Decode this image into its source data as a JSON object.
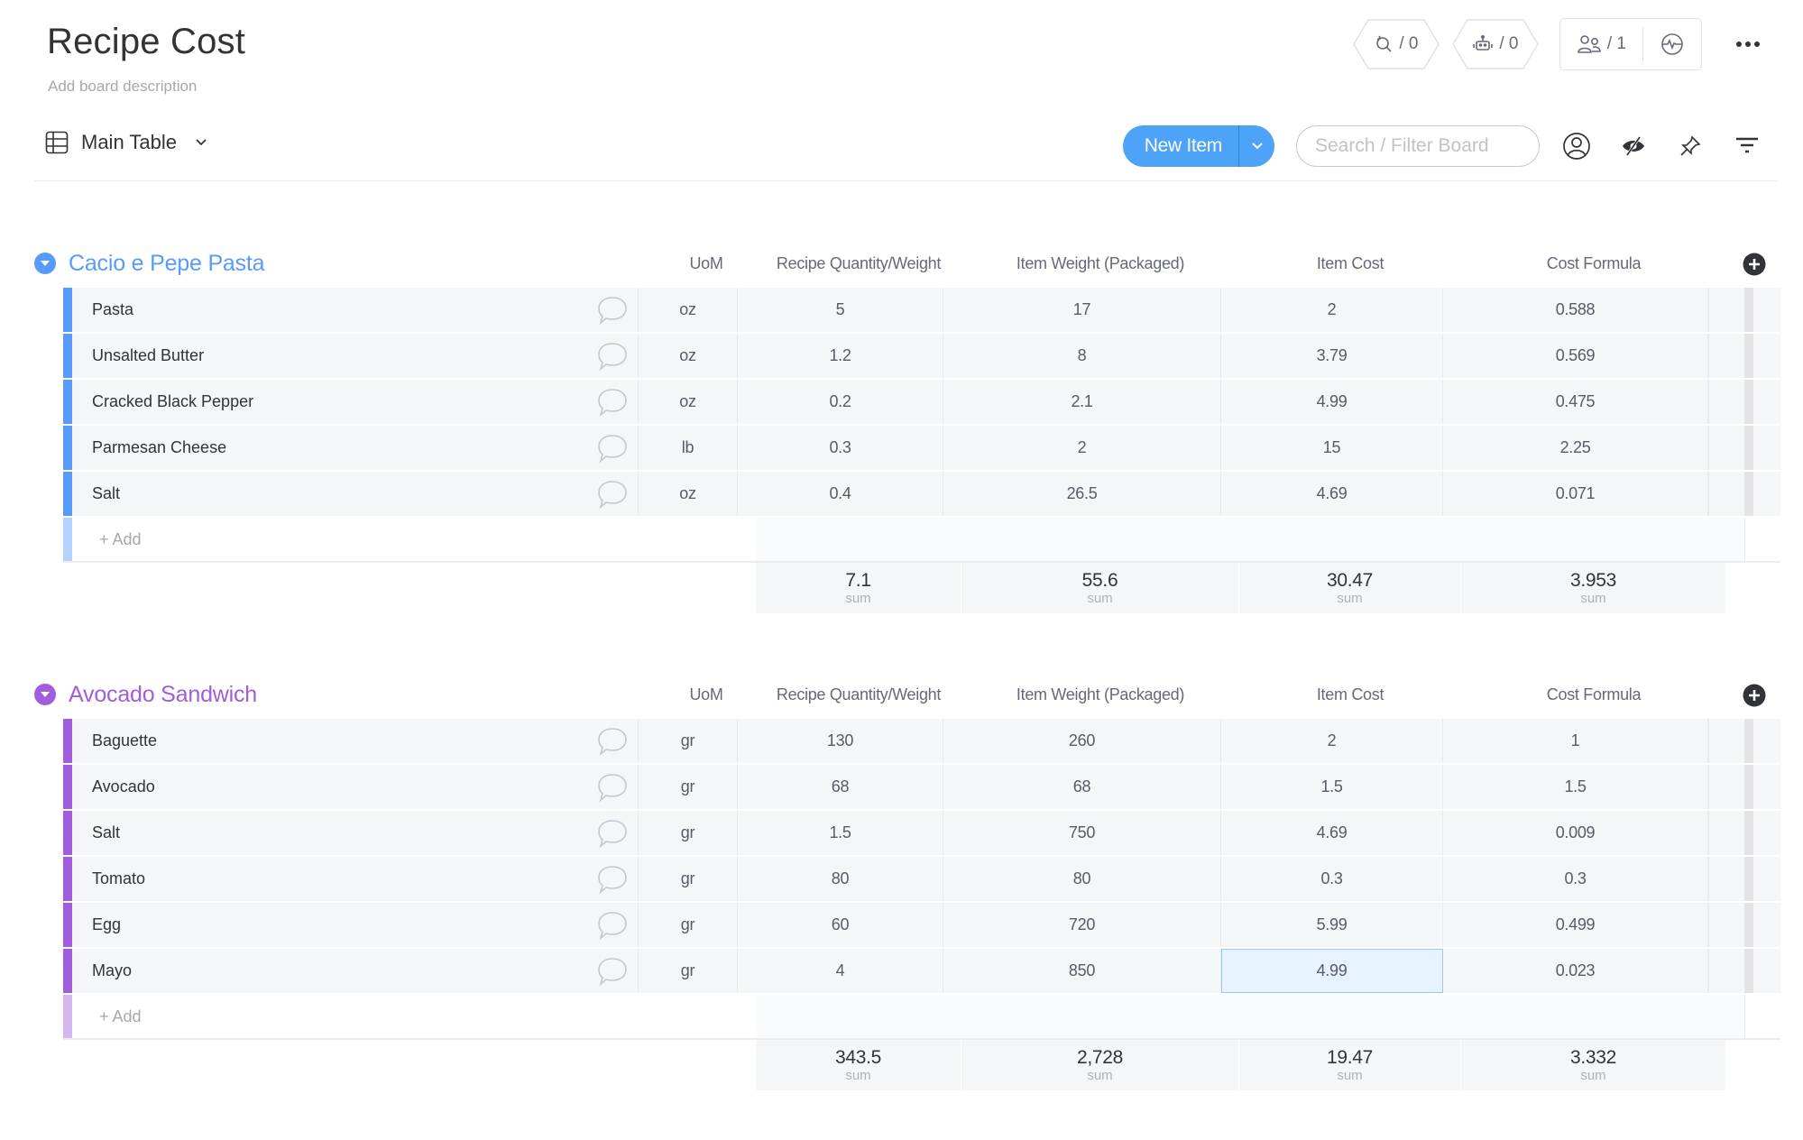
{
  "board": {
    "title": "Recipe Cost",
    "description": "Add board description"
  },
  "top_actions": {
    "integrations": {
      "icon": "integrations-icon",
      "label": "/ 0"
    },
    "automations": {
      "icon": "robot-icon",
      "label": "/ 0"
    },
    "members": {
      "icon": "people-icon",
      "label": "/ 1"
    },
    "activity": {
      "icon": "activity-icon"
    },
    "more": {
      "icon": "more-dots-icon"
    }
  },
  "view": {
    "icon": "table-icon",
    "label": "Main Table"
  },
  "toolbar": {
    "new_item_label": "New Item",
    "search_placeholder": "Search / Filter Board",
    "search_value": "",
    "icons": [
      "person-filter-icon",
      "hide-eye-icon",
      "pin-icon",
      "filter-icon"
    ]
  },
  "columns": [
    "UoM",
    "Recipe Quantity/Weight",
    "Item Weight (Packaged)",
    "Item Cost",
    "Cost Formula"
  ],
  "groups": [
    {
      "title": "Cacio e Pepe Pasta",
      "color": "#579bfc",
      "add_label": "+ Add",
      "items": [
        {
          "name": "Pasta",
          "uom": "oz",
          "qty": "5",
          "weight": "17",
          "cost": "2",
          "formula": "0.588"
        },
        {
          "name": "Unsalted Butter",
          "uom": "oz",
          "qty": "1.2",
          "weight": "8",
          "cost": "3.79",
          "formula": "0.569"
        },
        {
          "name": "Cracked Black Pepper",
          "uom": "oz",
          "qty": "0.2",
          "weight": "2.1",
          "cost": "4.99",
          "formula": "0.475"
        },
        {
          "name": "Parmesan Cheese",
          "uom": "lb",
          "qty": "0.3",
          "weight": "2",
          "cost": "15",
          "formula": "2.25"
        },
        {
          "name": "Salt",
          "uom": "oz",
          "qty": "0.4",
          "weight": "26.5",
          "cost": "4.69",
          "formula": "0.071"
        }
      ],
      "sums": [
        {
          "value": "7.1",
          "label": "sum"
        },
        {
          "value": "55.6",
          "label": "sum"
        },
        {
          "value": "30.47",
          "label": "sum"
        },
        {
          "value": "3.953",
          "label": "sum"
        }
      ]
    },
    {
      "title": "Avocado Sandwich",
      "color": "#a25ddc",
      "add_label": "+ Add",
      "items": [
        {
          "name": "Baguette",
          "uom": "gr",
          "qty": "130",
          "weight": "260",
          "cost": "2",
          "formula": "1"
        },
        {
          "name": "Avocado",
          "uom": "gr",
          "qty": "68",
          "weight": "68",
          "cost": "1.5",
          "formula": "1.5"
        },
        {
          "name": "Salt",
          "uom": "gr",
          "qty": "1.5",
          "weight": "750",
          "cost": "4.69",
          "formula": "0.009"
        },
        {
          "name": "Tomato",
          "uom": "gr",
          "qty": "80",
          "weight": "80",
          "cost": "0.3",
          "formula": "0.3"
        },
        {
          "name": "Egg",
          "uom": "gr",
          "qty": "60",
          "weight": "720",
          "cost": "5.99",
          "formula": "0.499"
        },
        {
          "name": "Mayo",
          "uom": "gr",
          "qty": "4",
          "weight": "850",
          "cost": "4.99",
          "formula": "0.023",
          "selected_cell": "cost"
        }
      ],
      "sums": [
        {
          "value": "343.5",
          "label": "sum"
        },
        {
          "value": "2,728",
          "label": "sum"
        },
        {
          "value": "19.47",
          "label": "sum"
        },
        {
          "value": "3.332",
          "label": "sum"
        }
      ]
    }
  ]
}
